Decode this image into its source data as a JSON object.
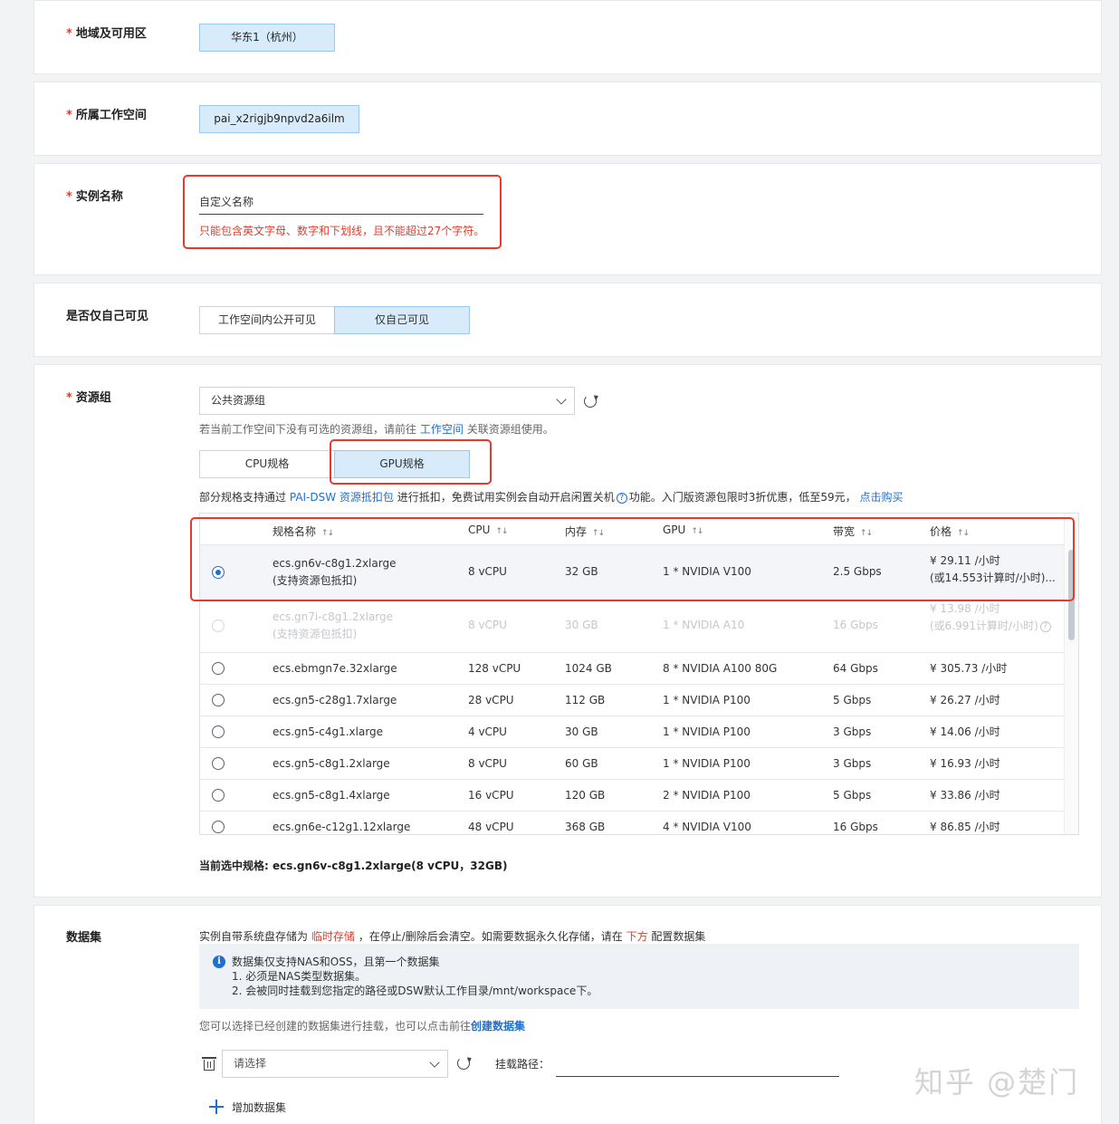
{
  "region": {
    "label": "地域及可用区",
    "value": "华东1（杭州）"
  },
  "workspace": {
    "label": "所属工作空间",
    "value": "pai_x2rigjb9npvd2a6ilm"
  },
  "instance_name": {
    "label": "实例名称",
    "value": "自定义名称",
    "hint": "只能包含英文字母、数字和下划线，且不能超过27个字符。"
  },
  "visibility": {
    "label": "是否仅自己可见",
    "options": [
      "工作空间内公开可见",
      "仅自己可见"
    ],
    "selected": "仅自己可见"
  },
  "resource_group": {
    "label": "资源组",
    "selected": "公共资源组",
    "hint_prefix": "若当前工作空间下没有可选的资源组，请前往",
    "hint_link": "工作空间",
    "hint_suffix": "关联资源组使用。",
    "tabs": [
      "CPU规格",
      "GPU规格"
    ],
    "active_tab": "GPU规格",
    "notice_prefix": "部分规格支持通过",
    "notice_link1": "PAI-DSW 资源抵扣包",
    "notice_mid": "进行抵扣，免费试用实例会自动开启闲置关机",
    "notice_mid2": "功能。入门版资源包限时3折优惠，低至59元，",
    "notice_link2": "点击购买",
    "columns": [
      "规格名称",
      "CPU",
      "内存",
      "GPU",
      "带宽",
      "价格"
    ],
    "rows": [
      {
        "name": "ecs.gn6v-c8g1.2xlarge",
        "name2": "(支持资源包抵扣)",
        "cpu": "8 vCPU",
        "mem": "32 GB",
        "gpu": "1 * NVIDIA V100",
        "bw": "2.5 Gbps",
        "price": "¥ 29.11 /小时",
        "price2": "(或14.553计算时/小时)...",
        "state": "selected"
      },
      {
        "name": "ecs.gn7i-c8g1.2xlarge",
        "name2": "(支持资源包抵扣)",
        "cpu": "8 vCPU",
        "mem": "30 GB",
        "gpu": "1 * NVIDIA A10",
        "bw": "16 Gbps",
        "price": "¥ 13.98 /小时",
        "price2": "(或6.991计算时/小时)",
        "state": "disabled"
      },
      {
        "name": "ecs.ebmgn7e.32xlarge",
        "cpu": "128 vCPU",
        "mem": "1024 GB",
        "gpu": "8 * NVIDIA A100 80G",
        "bw": "64 Gbps",
        "price": "¥ 305.73 /小时",
        "state": "normal"
      },
      {
        "name": "ecs.gn5-c28g1.7xlarge",
        "cpu": "28 vCPU",
        "mem": "112 GB",
        "gpu": "1 * NVIDIA P100",
        "bw": "5 Gbps",
        "price": "¥ 26.27 /小时",
        "state": "normal"
      },
      {
        "name": "ecs.gn5-c4g1.xlarge",
        "cpu": "4 vCPU",
        "mem": "30 GB",
        "gpu": "1 * NVIDIA P100",
        "bw": "3 Gbps",
        "price": "¥ 14.06 /小时",
        "state": "normal"
      },
      {
        "name": "ecs.gn5-c8g1.2xlarge",
        "cpu": "8 vCPU",
        "mem": "60 GB",
        "gpu": "1 * NVIDIA P100",
        "bw": "3 Gbps",
        "price": "¥ 16.93 /小时",
        "state": "normal"
      },
      {
        "name": "ecs.gn5-c8g1.4xlarge",
        "cpu": "16 vCPU",
        "mem": "120 GB",
        "gpu": "2 * NVIDIA P100",
        "bw": "5 Gbps",
        "price": "¥ 33.86 /小时",
        "state": "normal"
      },
      {
        "name": "ecs.gn6e-c12g1.12xlarge",
        "cpu": "48 vCPU",
        "mem": "368 GB",
        "gpu": "4 * NVIDIA V100",
        "bw": "16 Gbps",
        "price": "¥ 86.85 /小时",
        "state": "normal"
      }
    ],
    "current_spec": "当前选中规格: ecs.gn6v-c8g1.2xlarge(8 vCPU，32GB)"
  },
  "dataset": {
    "label": "数据集",
    "note_prefix": "实例自带系统盘存储为",
    "note_red1": "临时存储",
    "note_mid": "，在停止/删除后会清空。如需要数据永久化存储，请在",
    "note_red2": "下方",
    "note_suffix": "配置数据集",
    "info_lines": [
      "数据集仅支持NAS和OSS，且第一个数据集",
      "1. 必须是NAS类型数据集。",
      "2. 会被同时挂载到您指定的路径或DSW默认工作目录/mnt/workspace下。"
    ],
    "choose_prefix": "您可以选择已经创建的数据集进行挂载，也可以点击前往",
    "choose_link": "创建数据集",
    "select_placeholder": "请选择",
    "mount_label": "挂载路径：",
    "add_label": "增加数据集"
  },
  "watermark": "知乎 @楚门",
  "icons": [
    "chevron-down-icon",
    "refresh-icon",
    "info-icon",
    "question-icon",
    "trash-icon",
    "plus-icon",
    "sort-icon"
  ]
}
